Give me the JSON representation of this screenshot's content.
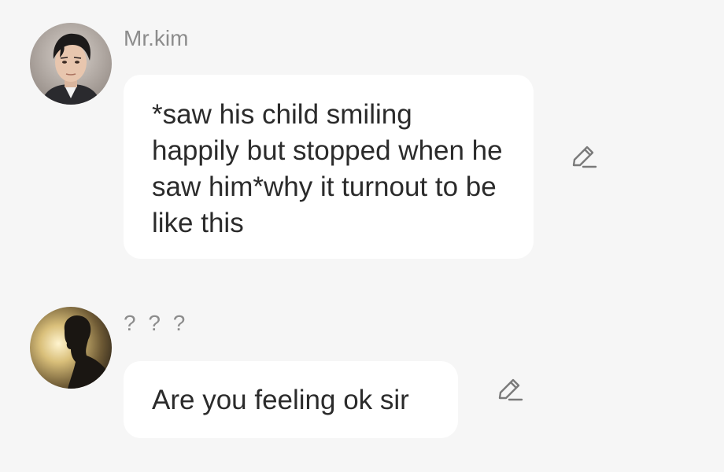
{
  "messages": [
    {
      "sender": "Mr.kim",
      "text": "*saw his child smiling happily but stopped when he saw him*why it turnout to be like this",
      "avatar": "man-portrait",
      "action_icon": "edit-pencil-icon"
    },
    {
      "sender": "? ? ?",
      "text": "Are you feeling ok sir",
      "avatar": "silhouette-portrait",
      "action_icon": "edit-pencil-icon"
    }
  ],
  "colors": {
    "background": "#f6f6f6",
    "bubble": "#ffffff",
    "sender_text": "#8c8c8c",
    "message_text": "#2b2b2b",
    "icon": "#7a7a7a"
  }
}
